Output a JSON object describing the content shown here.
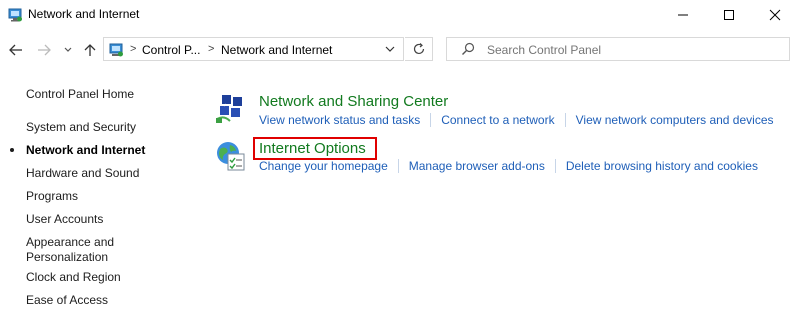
{
  "window": {
    "title": "Network and Internet",
    "icon": "control-panel-icon",
    "controls": [
      "minimize",
      "maximize",
      "close"
    ]
  },
  "navbar": {
    "breadcrumb": [
      "Control P...",
      "Network and Internet"
    ],
    "search_placeholder": "Search Control Panel"
  },
  "sidebar": {
    "home": "Control Panel Home",
    "items": [
      {
        "label": "System and Security"
      },
      {
        "label": "Network and Internet",
        "active": true
      },
      {
        "label": "Hardware and Sound"
      },
      {
        "label": "Programs"
      },
      {
        "label": "User Accounts"
      },
      {
        "label": "Appearance and Personalization"
      },
      {
        "label": "Clock and Region"
      },
      {
        "label": "Ease of Access"
      }
    ]
  },
  "categories": [
    {
      "title": "Network and Sharing Center",
      "icon": "network-sharing-icon",
      "links": [
        "View network status and tasks",
        "Connect to a network",
        "View network computers and devices"
      ]
    },
    {
      "title": "Internet Options",
      "icon": "internet-options-icon",
      "highlighted": true,
      "links": [
        "Change your homepage",
        "Manage browser add-ons",
        "Delete browsing history and cookies"
      ]
    }
  ],
  "colors": {
    "category_title": "#127a1f",
    "link": "#1f5fb8",
    "highlight": "#e00000"
  }
}
